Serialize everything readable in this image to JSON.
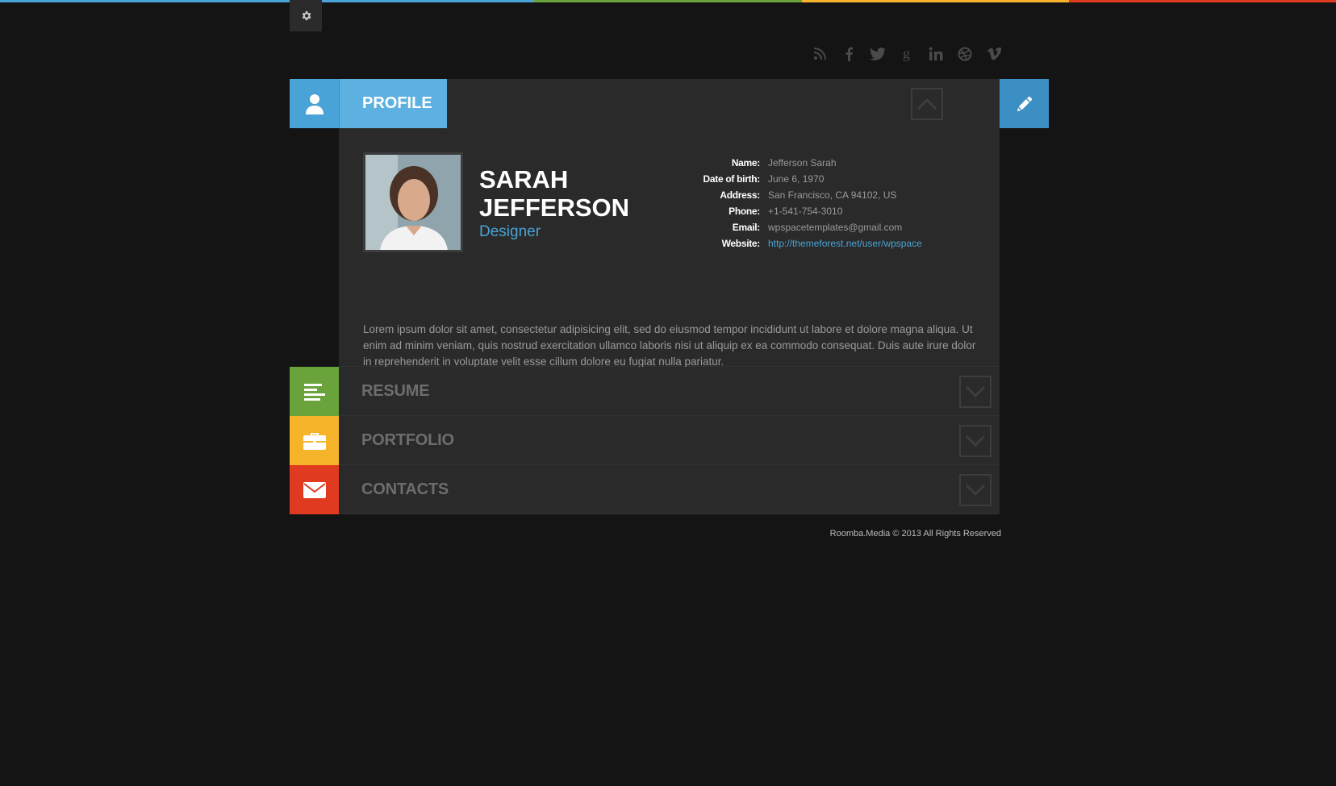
{
  "colors": {
    "topbar": [
      "#4aa3d6",
      "#4aa3d6",
      "#6aa33b",
      "#f6b42a",
      "#e03a20"
    ],
    "profile": "#4aa3d6",
    "resume": "#6aa33b",
    "portfolio": "#f6b42a",
    "contacts": "#e03a20"
  },
  "settings": {
    "icon": "gear-icon"
  },
  "social": [
    "rss-icon",
    "facebook-icon",
    "twitter-icon",
    "google-plus-icon",
    "linkedin-icon",
    "dribbble-icon",
    "vimeo-icon"
  ],
  "profile": {
    "tab_label": "PROFILE",
    "first_name": "SARAH",
    "last_name": "JEFFERSON",
    "role": "Designer",
    "info": [
      {
        "key": "Name:",
        "value": "Jefferson Sarah"
      },
      {
        "key": "Date of birth:",
        "value": "June 6, 1970"
      },
      {
        "key": "Address:",
        "value": "San Francisco, CA 94102, US"
      },
      {
        "key": "Phone:",
        "value": "+1-541-754-3010"
      },
      {
        "key": "Email:",
        "value": "wpspacetemplates@gmail.com"
      },
      {
        "key": "Website:",
        "value": "http://themeforest.net/user/wpspace"
      }
    ],
    "bio": "Lorem ipsum dolor sit amet, consectetur adipisicing elit, sed do eiusmod tempor incididunt ut labore et dolore magna aliqua. Ut enim ad minim veniam, quis nostrud exercitation ullamco laboris nisi ut aliquip ex ea commodo consequat. Duis aute irure dolor in reprehenderit in voluptate velit esse cillum dolore eu fugiat nulla pariatur."
  },
  "sections": [
    {
      "label": "RESUME",
      "icon": "list-icon"
    },
    {
      "label": "PORTFOLIO",
      "icon": "briefcase-icon"
    },
    {
      "label": "CONTACTS",
      "icon": "envelope-icon"
    }
  ],
  "footer": "Roomba.Media © 2013 All Rights Reserved"
}
